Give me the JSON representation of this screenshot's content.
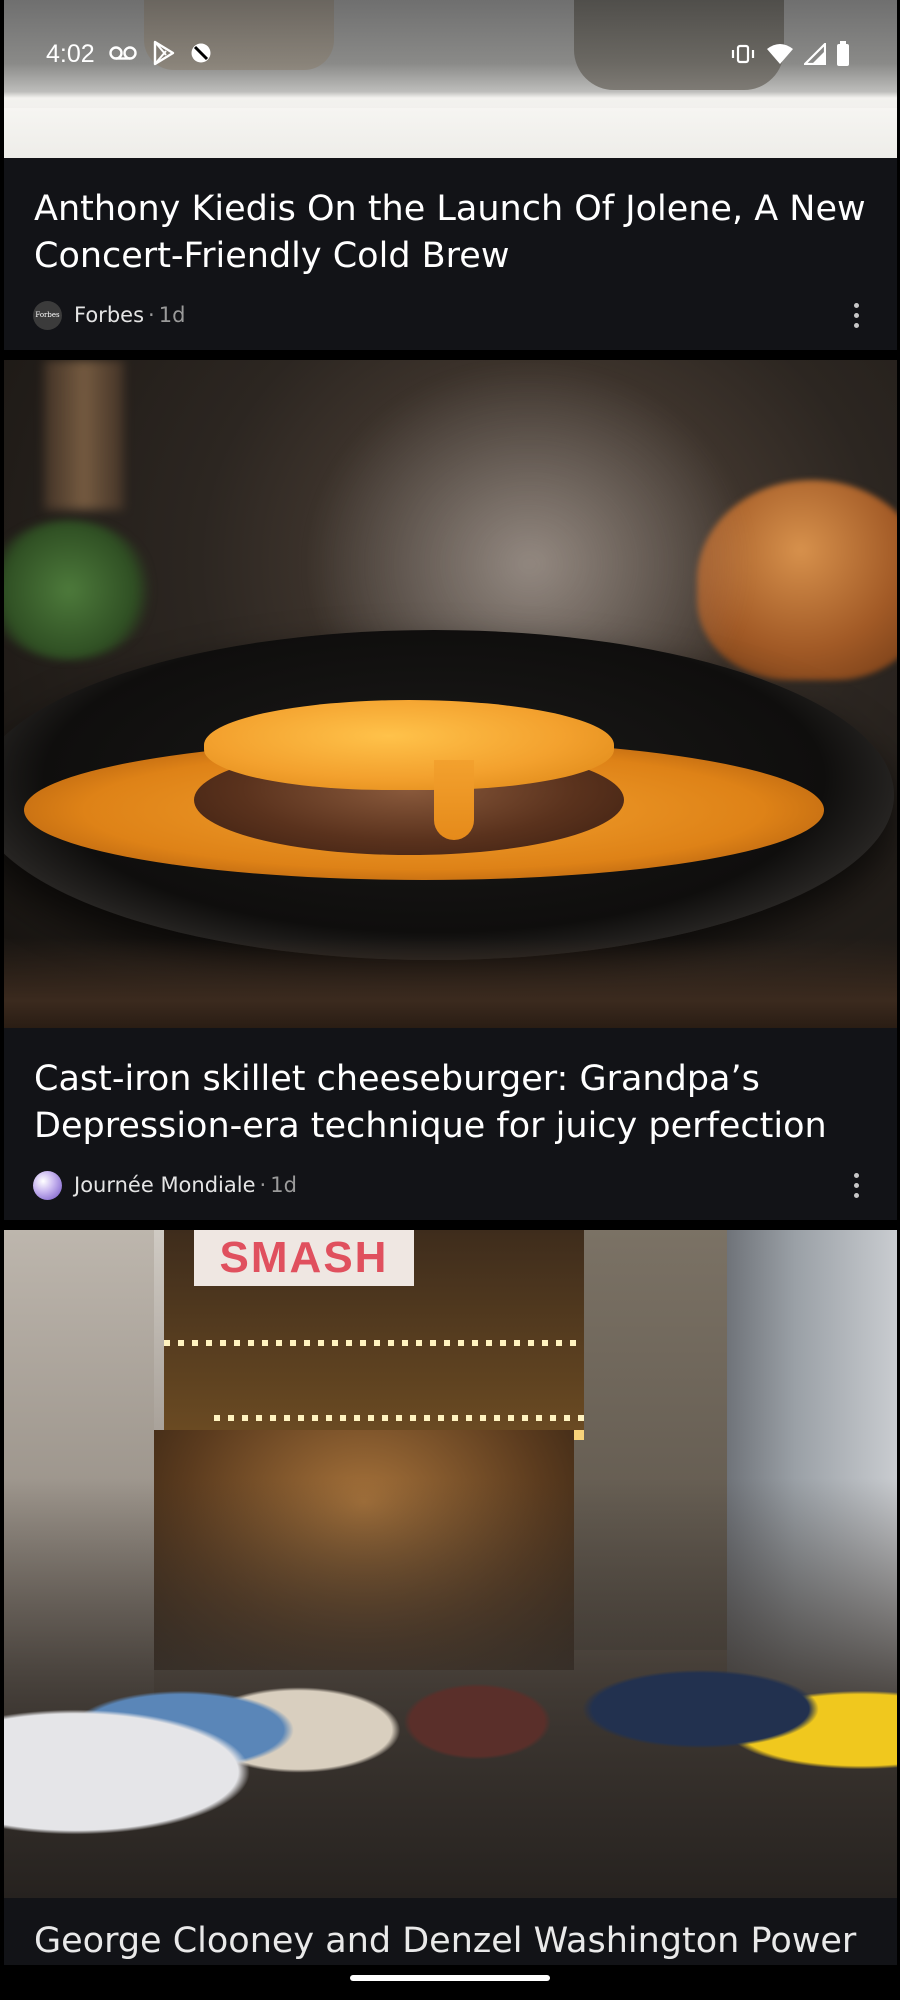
{
  "status_bar": {
    "time": "4:02",
    "left_icons": [
      "voicemail-icon",
      "play-store-icon",
      "do-not-disturb-icon"
    ],
    "right_icons": [
      "vibrate-icon",
      "wifi-icon",
      "cell-signal-icon",
      "battery-icon"
    ]
  },
  "feed": {
    "articles": [
      {
        "title": "Anthony Kiedis On the Launch Of Jolene, A New Concert-Friendly Cold Brew",
        "source": "Forbes",
        "source_logo_text": "Forbes",
        "separator": "·",
        "age": "1d"
      },
      {
        "title": "Cast-iron skillet cheeseburger: Grandpa’s Depression-era technique for juicy perfection",
        "source": "Journée Mondiale",
        "separator": "·",
        "age": "1d"
      },
      {
        "title": "George Clooney and Denzel Washington Power",
        "image_sign_text": "SMASH"
      }
    ]
  }
}
